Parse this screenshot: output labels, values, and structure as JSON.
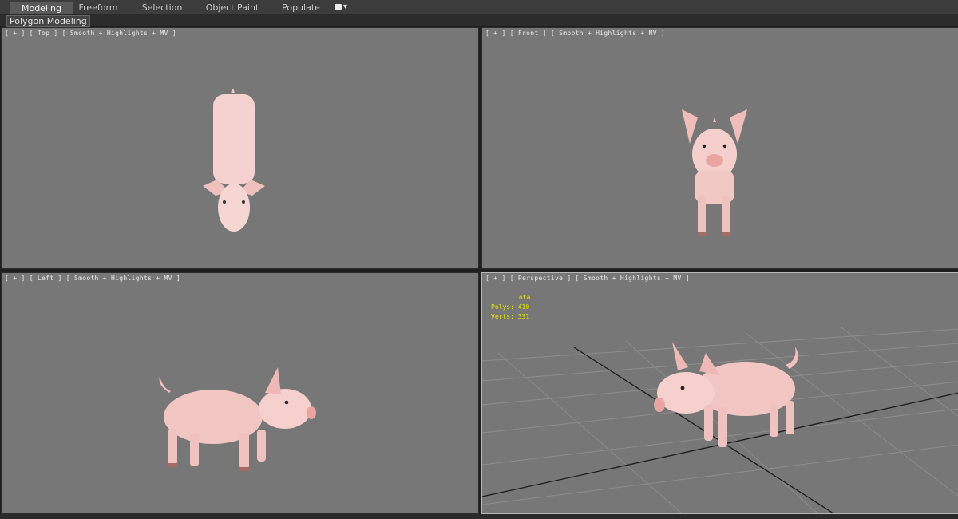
{
  "ribbon": {
    "tabs": [
      {
        "label": "Modeling",
        "active": true
      },
      {
        "label": "Freeform",
        "active": false
      },
      {
        "label": "Selection",
        "active": false
      },
      {
        "label": "Object Paint",
        "active": false
      },
      {
        "label": "Populate",
        "active": false
      }
    ],
    "panel_label": "Polygon Modeling"
  },
  "viewports": {
    "top": {
      "label": "[ + ] [ Top ] [ Smooth + Highlights + MV ]"
    },
    "front": {
      "label": "[ + ] [ Front ] [ Smooth + Highlights + MV ]"
    },
    "left": {
      "label": "[ + ] [ Left ] [ Smooth + Highlights + MV ]"
    },
    "perspective": {
      "label": "[ + ] [ Perspective ] [ Smooth + Highlights + MV ]",
      "stats": {
        "total_label": "Total",
        "polys": "Polys: 410",
        "verts": "Verts: 331"
      }
    }
  },
  "colors": {
    "viewport_bg": "#777777",
    "pig_skin": "#f2c8c4",
    "stats_text": "#e6e600"
  }
}
